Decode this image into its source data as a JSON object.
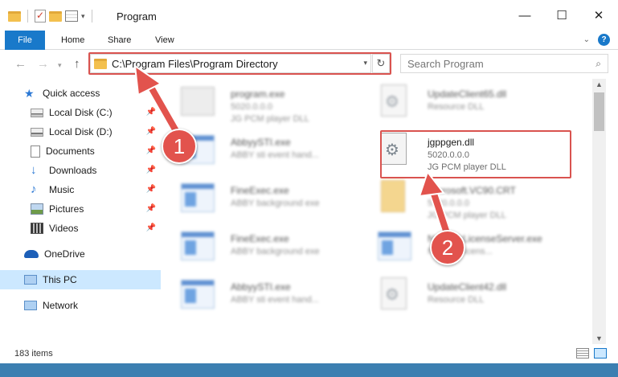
{
  "window": {
    "title": "Program",
    "minimize_icon": "minimize-icon",
    "maximize_icon": "maximize-icon",
    "close_icon": "close-icon",
    "min_glyph": "—",
    "max_glyph": "☐",
    "close_glyph": "✕"
  },
  "quick_access_toolbar": {
    "check_glyph": "✓",
    "caret_glyph": "▾"
  },
  "ribbon": {
    "tabs": [
      {
        "label": "File"
      },
      {
        "label": "Home"
      },
      {
        "label": "Share"
      },
      {
        "label": "View"
      }
    ],
    "expand_glyph": "⌄",
    "help_glyph": "?"
  },
  "navigation": {
    "back_glyph": "←",
    "forward_glyph": "→",
    "recent_glyph": "▾",
    "up_glyph": "↑",
    "address_path": "C:\\Program Files\\Program Directory",
    "address_drop_glyph": "▾",
    "refresh_glyph": "↻",
    "search_placeholder": "Search Program",
    "search_glyph": "⌕"
  },
  "sidebar": {
    "pin_glyph": "📌",
    "items": [
      {
        "label": "Quick access",
        "icon": "star-icon",
        "glyph": "★"
      },
      {
        "label": "Local Disk (C:)",
        "icon": "disk-icon"
      },
      {
        "label": "Local Disk (D:)",
        "icon": "disk-icon"
      },
      {
        "label": "Documents",
        "icon": "documents-icon"
      },
      {
        "label": "Downloads",
        "icon": "downloads-icon",
        "glyph": "↓"
      },
      {
        "label": "Music",
        "icon": "music-icon",
        "glyph": "♪"
      },
      {
        "label": "Pictures",
        "icon": "pictures-icon"
      },
      {
        "label": "Videos",
        "icon": "videos-icon"
      },
      {
        "label": "OneDrive",
        "icon": "cloud-icon"
      },
      {
        "label": "This PC",
        "icon": "computer-icon"
      },
      {
        "label": "Network",
        "icon": "network-icon"
      }
    ]
  },
  "files": [
    {
      "name": "program.exe",
      "line1": "5020.0.0.0",
      "line2": "JG PCM player DLL"
    },
    {
      "name": "UpdateClient65.dll",
      "line1": "Resource DLL",
      "line2": ""
    },
    {
      "name": "AbbyySTI.exe",
      "line1": "ABBY sti event hand...",
      "line2": ""
    },
    {
      "name": "jgppgen.dll",
      "line1": "5020.0.0.0",
      "line2": "JG PCM player DLL"
    },
    {
      "name": "FineExec.exe",
      "line1": "ABBY background exe",
      "line2": ""
    },
    {
      "name": "Microsoft.VC90.CRT",
      "line1": "5020.0.0.0",
      "line2": "JG PCM player DLL"
    },
    {
      "name": "FineExec.exe",
      "line1": "ABBY background exe",
      "line2": ""
    },
    {
      "name": "NetworkLicenseServer.exe",
      "line1": "Network licens...",
      "line2": ""
    },
    {
      "name": "AbbyySTI.exe",
      "line1": "ABBY sti event hand...",
      "line2": ""
    },
    {
      "name": "UpdateClient42.dll",
      "line1": "Resource DLL",
      "line2": ""
    }
  ],
  "scrollbar": {
    "up_glyph": "▲",
    "down_glyph": "▼"
  },
  "status": {
    "item_count": "183 items"
  },
  "annotations": {
    "step1": "1",
    "step2": "2",
    "highlight_color": "#d9534f"
  }
}
